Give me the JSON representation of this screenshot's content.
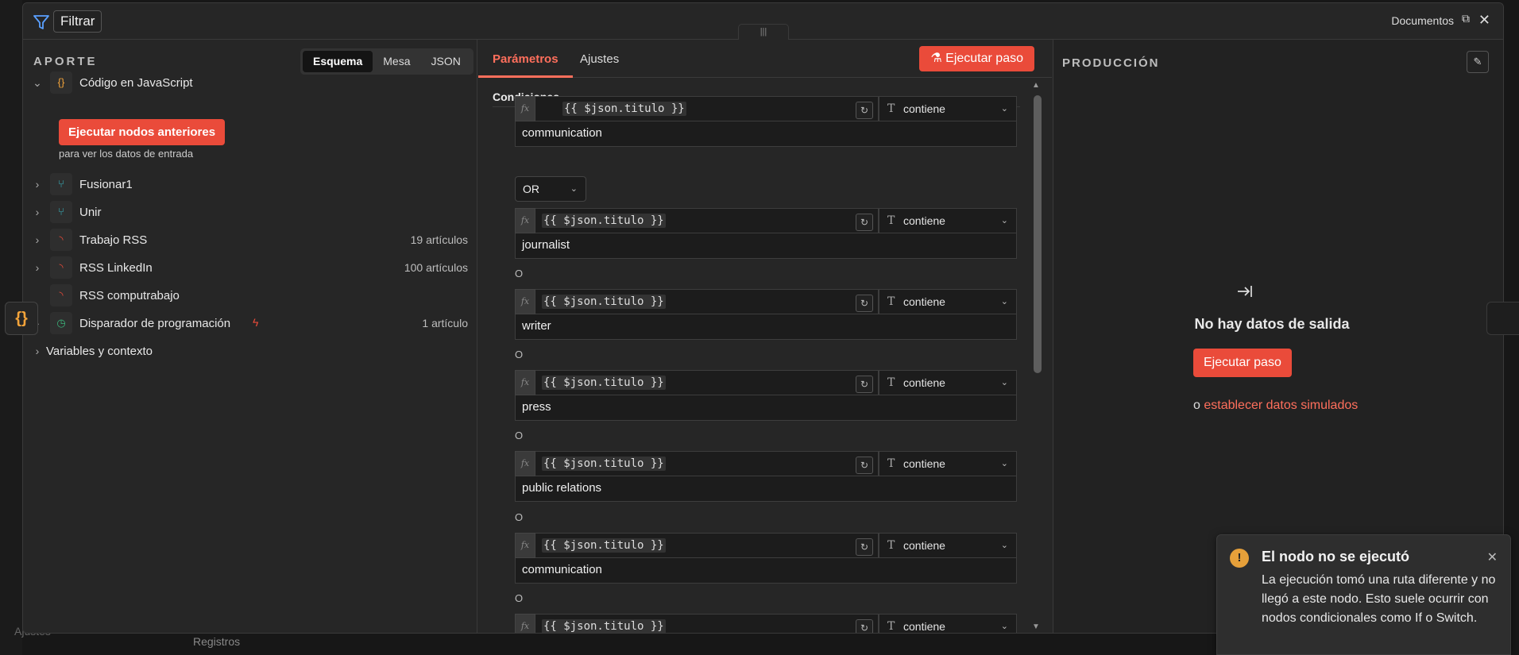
{
  "header": {
    "node_name": "Filtrar",
    "docs_label": "Documentos"
  },
  "input": {
    "title": "APORTE",
    "view_tabs": [
      "Esquema",
      "Mesa",
      "JSON"
    ],
    "tree": [
      {
        "label": "Código en JavaScript",
        "count": ""
      },
      {
        "label": "Fusionar1",
        "count": ""
      },
      {
        "label": "Unir",
        "count": ""
      },
      {
        "label": "Trabajo RSS",
        "count": "19 artículos"
      },
      {
        "label": "RSS LinkedIn",
        "count": "100 artículos"
      },
      {
        "label": "RSS computrabajo",
        "count": ""
      },
      {
        "label": "Disparador de programación",
        "count": "1 artículo"
      },
      {
        "label": "Variables y contexto",
        "count": ""
      }
    ],
    "run_prev_label": "Ejecutar nodos anteriores",
    "run_prev_hint": "para ver los datos de entrada"
  },
  "params": {
    "tabs": [
      "Parámetros",
      "Ajustes"
    ],
    "exec_label": "Ejecutar paso",
    "section_title": "Condiciones",
    "combinator": "OR",
    "or_label": "O",
    "conditions": [
      {
        "expr": "{{ $json.titulo }}",
        "op": "contiene",
        "value": "communication"
      },
      {
        "expr": "{{ $json.titulo }}",
        "op": "contiene",
        "value": "journalist"
      },
      {
        "expr": "{{ $json.titulo }}",
        "op": "contiene",
        "value": "writer"
      },
      {
        "expr": "{{ $json.titulo }}",
        "op": "contiene",
        "value": "press"
      },
      {
        "expr": "{{ $json.titulo }}",
        "op": "contiene",
        "value": "public relations"
      },
      {
        "expr": "{{ $json.titulo }}",
        "op": "contiene",
        "value": "communication"
      },
      {
        "expr": "{{ $json.titulo }}",
        "op": "contiene",
        "value": ""
      }
    ]
  },
  "output": {
    "title": "PRODUCCIÓN",
    "no_data": "No hay datos de salida",
    "run_label": "Ejecutar paso",
    "mock_prefix": "o",
    "mock_link": "establecer datos simulados"
  },
  "toast": {
    "title": "El nodo no se ejecutó",
    "body": "La ejecución tomó una ruta diferente y no llegó a este nodo. Esto suele ocurrir con nodos condicionales como If o Switch."
  },
  "background": {
    "settings_label": "Ajustes",
    "logs_label": "Registros"
  },
  "colors": {
    "accent": "#ea4b3a",
    "accent_text": "#ff6f5c",
    "warning": "#e6a03a",
    "panel": "#262626"
  }
}
